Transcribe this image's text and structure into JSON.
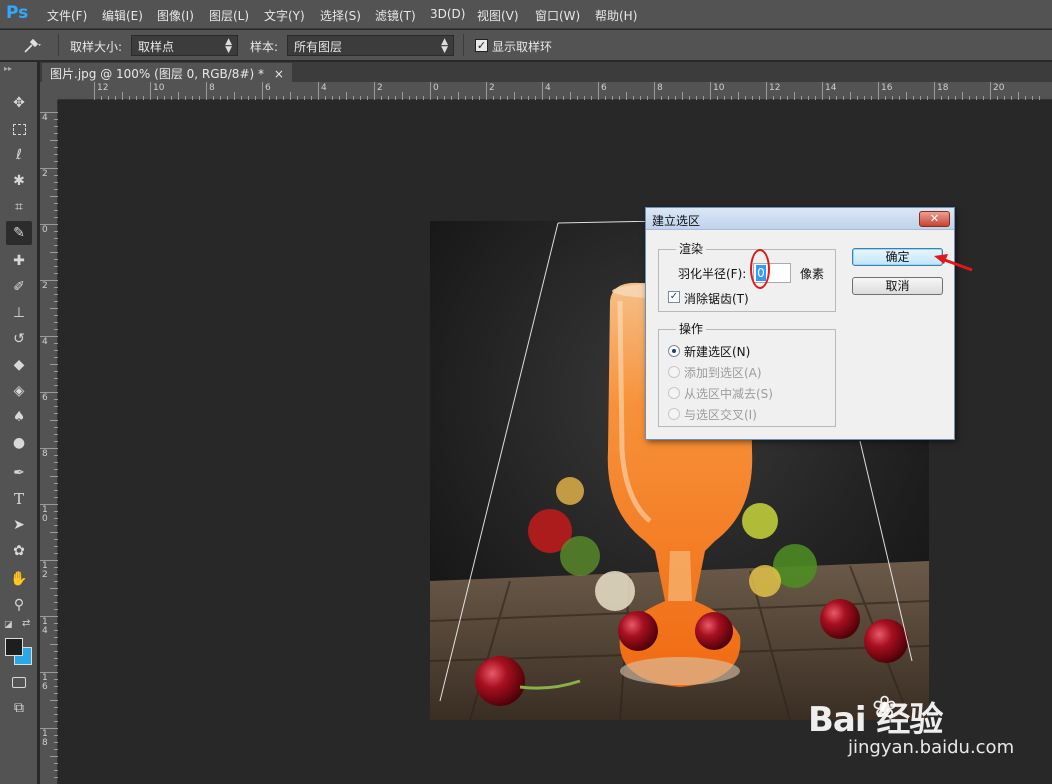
{
  "app": {
    "logo": "Ps"
  },
  "menu": [
    {
      "label": "文件(F)"
    },
    {
      "label": "编辑(E)"
    },
    {
      "label": "图像(I)"
    },
    {
      "label": "图层(L)"
    },
    {
      "label": "文字(Y)"
    },
    {
      "label": "选择(S)"
    },
    {
      "label": "滤镜(T)"
    },
    {
      "label": "3D(D)"
    },
    {
      "label": "视图(V)"
    },
    {
      "label": "窗口(W)"
    },
    {
      "label": "帮助(H)"
    }
  ],
  "options": {
    "sample_size_label": "取样大小:",
    "sample_size_value": "取样点",
    "sample_label": "样本:",
    "sample_value": "所有图层",
    "show_ring_label": "显示取样环",
    "show_ring_checked": true
  },
  "document": {
    "tab_title": "图片.jpg @ 100% (图层 0, RGB/8#) *",
    "close": "×"
  },
  "rulers": {
    "h_labels": [
      "12",
      "10",
      "8",
      "6",
      "4",
      "2",
      "0",
      "2",
      "4",
      "6",
      "8",
      "10",
      "12",
      "14",
      "16",
      "18",
      "20"
    ],
    "v_labels": [
      "4",
      "2",
      "0",
      "2",
      "4",
      "6",
      "8",
      "1 0",
      "1 2",
      "1 4",
      "1 6",
      "1 8"
    ]
  },
  "tools": [
    "move-icon",
    "marquee-icon",
    "lasso-icon",
    "magic-wand-icon",
    "crop-icon",
    "eyedropper-icon",
    "healing-brush-icon",
    "brush-icon",
    "clone-stamp-icon",
    "history-brush-icon",
    "eraser-icon",
    "paint-bucket-icon",
    "blur-icon",
    "dodge-icon",
    "pen-icon",
    "type-icon",
    "path-select-icon",
    "shape-icon",
    "hand-icon",
    "zoom-icon"
  ],
  "dialog": {
    "title": "建立选区",
    "close": "✕",
    "render_group": "渲染",
    "feather_label": "羽化半径(F):",
    "feather_value": "0",
    "feather_unit": "像素",
    "antialias_label": "消除锯齿(T)",
    "antialias_checked": true,
    "operation_group": "操作",
    "operations": [
      {
        "label": "新建选区(N)",
        "selected": true,
        "enabled": true
      },
      {
        "label": "添加到选区(A)",
        "selected": false,
        "enabled": false
      },
      {
        "label": "从选区中减去(S)",
        "selected": false,
        "enabled": false
      },
      {
        "label": "与选区交叉(I)",
        "selected": false,
        "enabled": false
      }
    ],
    "ok_label": "确定",
    "cancel_label": "取消"
  },
  "colors": {
    "accent": "#31a8ff",
    "foreground_swatch": "#1e1e1e",
    "background_swatch": "#2aa8e6",
    "annotation_red": "#e01818"
  },
  "watermark": {
    "logo": "Bai  经验",
    "url": "jingyan.baidu.com"
  }
}
